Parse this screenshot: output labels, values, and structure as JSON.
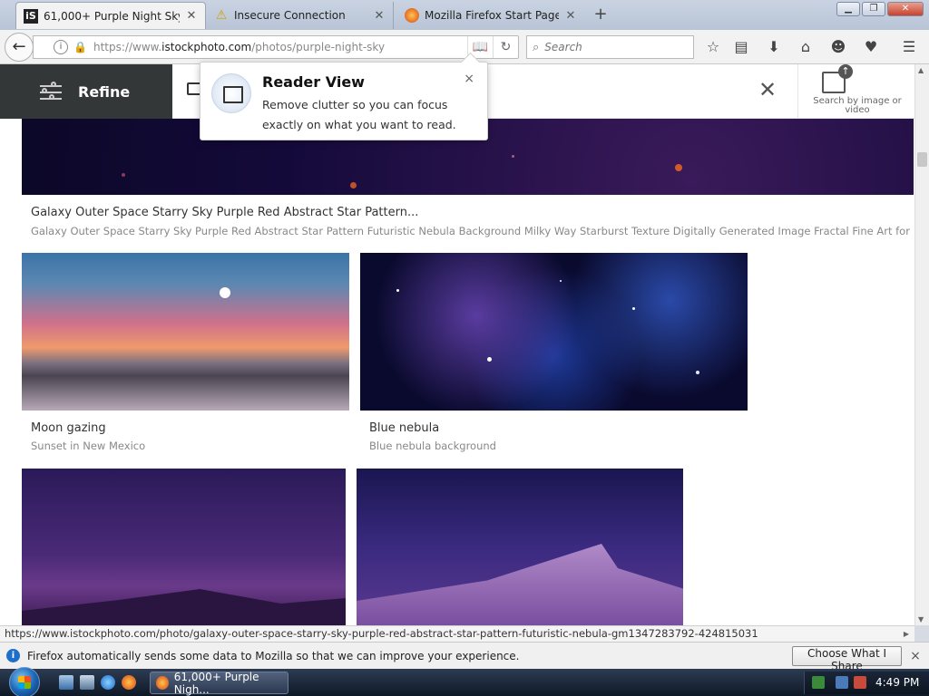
{
  "browser": {
    "tabs": [
      {
        "label": "61,000+ Purple Night Sky S...",
        "favicon": "istock-favicon",
        "active": true
      },
      {
        "label": "Insecure Connection",
        "favicon": "warning-icon",
        "active": false
      },
      {
        "label": "Mozilla Firefox Start Page",
        "favicon": "firefox-icon",
        "active": false
      }
    ],
    "url": {
      "prefix": "https://www.",
      "domain": "istockphoto.com",
      "path": "/photos/purple-night-sky"
    },
    "search_placeholder": "Search",
    "icons": [
      "back-icon",
      "info-icon",
      "lock-icon",
      "reader-view-icon",
      "reload-icon",
      "search-icon",
      "bookmark-star-icon",
      "reading-list-icon",
      "download-icon",
      "home-icon",
      "chat-icon",
      "pocket-icon",
      "menu-icon"
    ]
  },
  "page": {
    "refine_label": "Refine",
    "search_by_image_label": "Search by image or video",
    "items": [
      {
        "title": "Galaxy Outer Space Starry Sky Purple Red Abstract Star Pattern...",
        "subtitle": "Galaxy Outer Space Starry Sky Purple Red Abstract Star Pattern Futuristic Nebula Background Milky Way Starburst Texture Digitally Generated Image Fractal Fine Art for"
      },
      {
        "title": "Moon gazing",
        "subtitle": "Sunset in New Mexico"
      },
      {
        "title": "Blue nebula",
        "subtitle": "Blue nebula background"
      }
    ]
  },
  "popup": {
    "title": "Reader View",
    "body": "Remove clutter so you can focus exactly on what you want to read.",
    "close": "×"
  },
  "status_url": "https://www.istockphoto.com/photo/galaxy-outer-space-starry-sky-purple-red-abstract-star-pattern-futuristic-nebula-gm1347283792-424815031",
  "notification": {
    "message": "Firefox automatically sends some data to Mozilla so that we can improve your experience.",
    "button": "Choose What I Share",
    "close": "×"
  },
  "taskbar": {
    "task_label": "61,000+ Purple Nigh...",
    "clock": "4:49 PM"
  },
  "colors": {
    "refine_bg": "#333738",
    "firefox_blue": "#1e6fc9",
    "lock_green": "#3a9c3a"
  }
}
